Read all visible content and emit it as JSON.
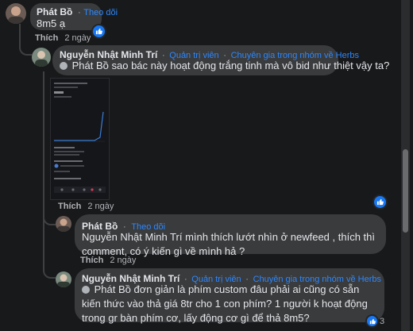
{
  "comments": [
    {
      "author": "Phát Bồ",
      "follow": "Theo dõi",
      "text": "8m5 ạ",
      "like_label": "Thích",
      "time": "2 ngày"
    },
    {
      "author": "Nguyễn Nhật Minh Trí",
      "badge_admin": "Quản trị viên",
      "badge_expert": "Chuyên gia trong nhóm về Herbs",
      "mention": "Phát Bồ",
      "text": " sao bác này hoạt động trắng tinh mà vô bid như thiệt vậy ta?",
      "like_label": "Thích",
      "time": "2 ngày"
    },
    {
      "author": "Phát Bồ",
      "follow": "Theo dõi",
      "mention": "Nguyễn Nhật Minh Trí",
      "text": " mình thích lướt nhìn ở newfeed , thích thì comment, có ý kiến gì về mình hả ?",
      "like_label": "Thích",
      "time": "2 ngày"
    },
    {
      "author": "Nguyễn Nhật Minh Trí",
      "badge_admin": "Quản trị viên",
      "badge_expert": "Chuyên gia trong nhóm về Herbs",
      "mention": "Phát Bồ",
      "text": " đơn giản là phím custom đâu phải ai cũng có sẵn kiến thức vào thả giá 8tr cho 1 con phím? 1 người k hoạt động trong gr bàn phím cơ, lấy động cơ gì để thả 8m5?",
      "reaction_count": "3"
    }
  ],
  "colors": {
    "accent": "#2d88ff",
    "like": "#1877f2",
    "bubble": "#3a3b3c",
    "background": "#18191a"
  },
  "icons": [
    "like-icon",
    "verified-icon"
  ]
}
